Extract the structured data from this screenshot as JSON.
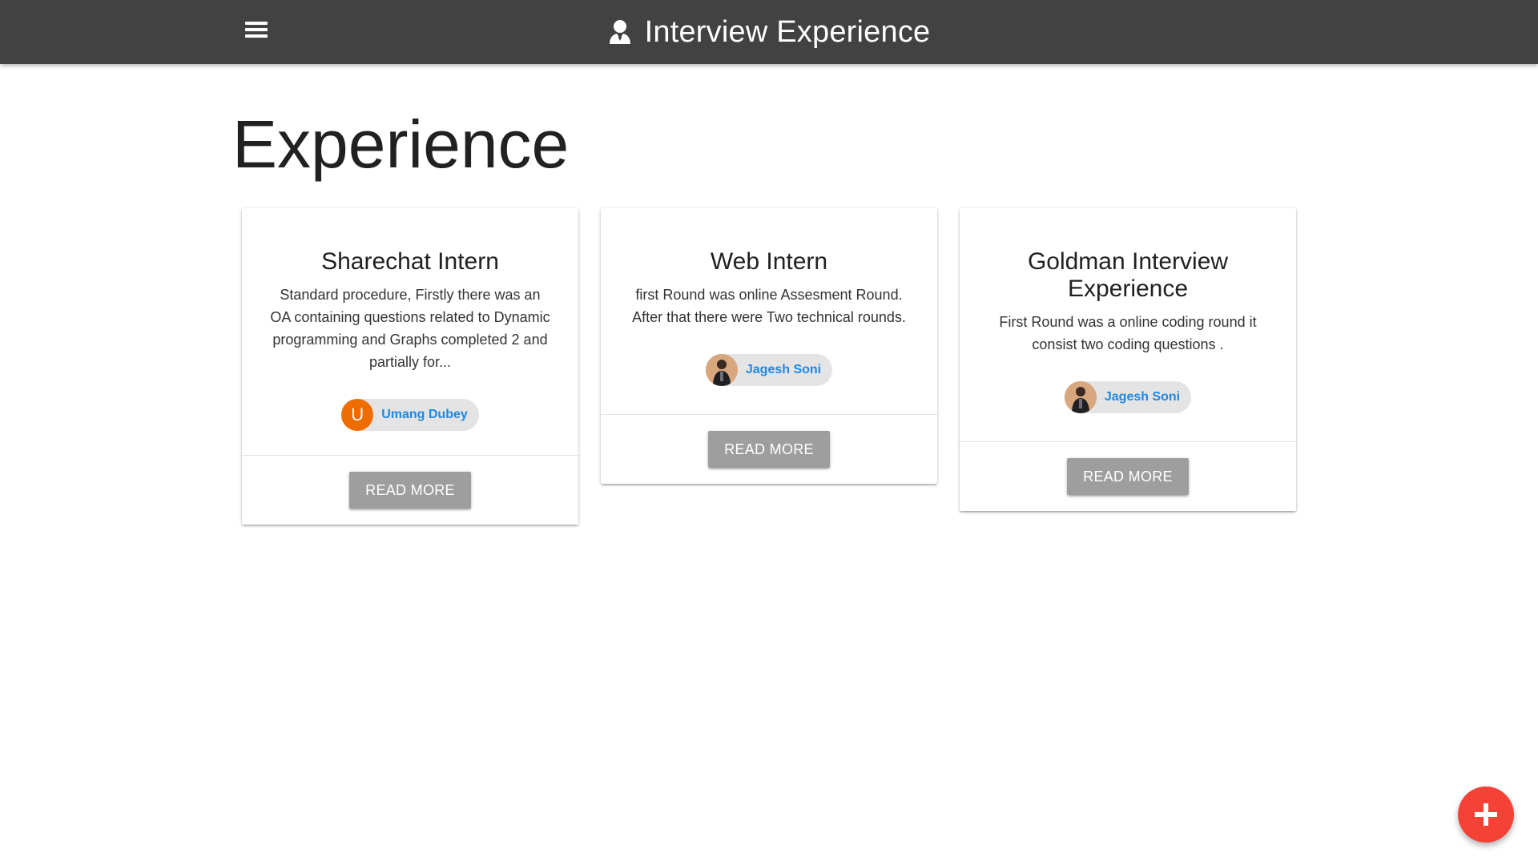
{
  "header": {
    "app_title": "Interview Experience",
    "menu_icon": "hamburger-menu-icon",
    "brand_icon": "user-tie-icon",
    "background": "#424242"
  },
  "page": {
    "title": "Experience"
  },
  "cards": [
    {
      "title": "Sharechat Intern",
      "summary": "Standard procedure, Firstly there was an OA containing questions related to Dynamic programming and Graphs completed 2 and partially for...",
      "author": "Umang Dubey",
      "author_initial": "U",
      "author_avatar_type": "letter",
      "button_label": "READ MORE"
    },
    {
      "title": "Web Intern",
      "summary": "first Round was online Assesment Round. After that there were Two technical rounds.",
      "author": "Jagesh Soni",
      "author_avatar_type": "photo",
      "button_label": "READ MORE"
    },
    {
      "title": "Goldman Interview Experience",
      "summary": "First Round was a online coding round it consist two coding questions .",
      "author": "Jagesh Soni",
      "author_avatar_type": "photo",
      "button_label": "READ MORE"
    }
  ],
  "fab": {
    "icon": "plus-icon",
    "color": "#f44336"
  },
  "colors": {
    "author_link": "#1e88e5",
    "button": "#9e9e9e",
    "letter_avatar": "#ef6c00"
  }
}
